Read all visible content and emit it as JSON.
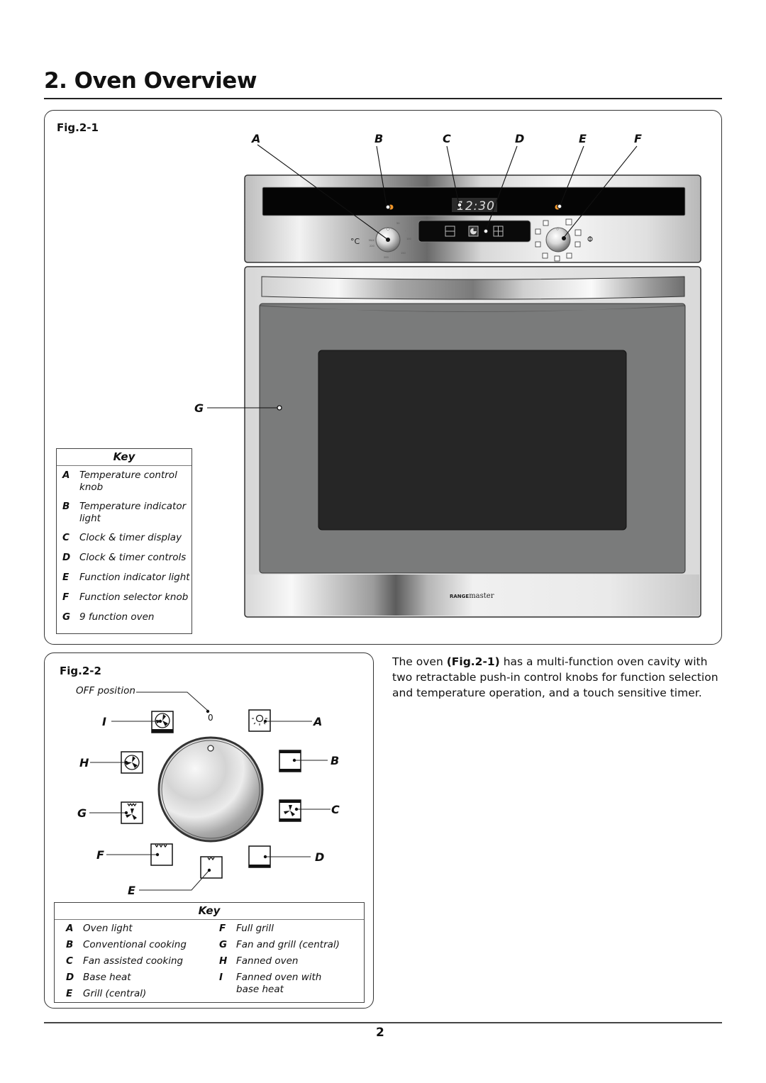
{
  "page": {
    "section_title": "2. Oven Overview",
    "page_number": "2"
  },
  "fig1": {
    "label": "Fig.2-1",
    "callouts": [
      "A",
      "B",
      "C",
      "D",
      "E",
      "F"
    ],
    "callout_g": "G",
    "display_time": "12:30",
    "temp_unit": "°C",
    "brand": "RANGEmaster",
    "brand_parts": {
      "caps": "RANGE",
      "lower": "master"
    },
    "indicator_color": "#f0962a",
    "key": {
      "title": "Key",
      "items": [
        {
          "letter": "A",
          "text": "Temperature control knob"
        },
        {
          "letter": "B",
          "text": "Temperature indicator light"
        },
        {
          "letter": "C",
          "text": "Clock & timer display"
        },
        {
          "letter": "D",
          "text": "Clock & timer controls"
        },
        {
          "letter": "E",
          "text": "Function indicator light"
        },
        {
          "letter": "F",
          "text": "Function selector knob"
        },
        {
          "letter": "G",
          "text": "9 function oven"
        }
      ]
    }
  },
  "fig2": {
    "label": "Fig.2-2",
    "off_label": "OFF position",
    "off_mark": "0",
    "letters": {
      "A": "A",
      "B": "B",
      "C": "C",
      "D": "D",
      "E": "E",
      "F": "F",
      "G": "G",
      "H": "H",
      "I": "I"
    },
    "key": {
      "title": "Key",
      "left": [
        {
          "letter": "A",
          "text": "Oven light"
        },
        {
          "letter": "B",
          "text": "Conventional cooking"
        },
        {
          "letter": "C",
          "text": "Fan assisted cooking"
        },
        {
          "letter": "D",
          "text": "Base heat"
        },
        {
          "letter": "E",
          "text": "Grill (central)"
        }
      ],
      "right": [
        {
          "letter": "F",
          "text": "Full grill"
        },
        {
          "letter": "G",
          "text": "Fan and grill (central)"
        },
        {
          "letter": "H",
          "text": "Fanned oven"
        },
        {
          "letter": "I",
          "text": "Fanned oven with base heat"
        }
      ]
    }
  },
  "description": {
    "pre": "The oven ",
    "ref": "(Fig.2-1)",
    "post": " has a multi-function oven cavity with two retractable push-in control knobs for function selection and temperature operation, and a touch sensitive timer."
  }
}
